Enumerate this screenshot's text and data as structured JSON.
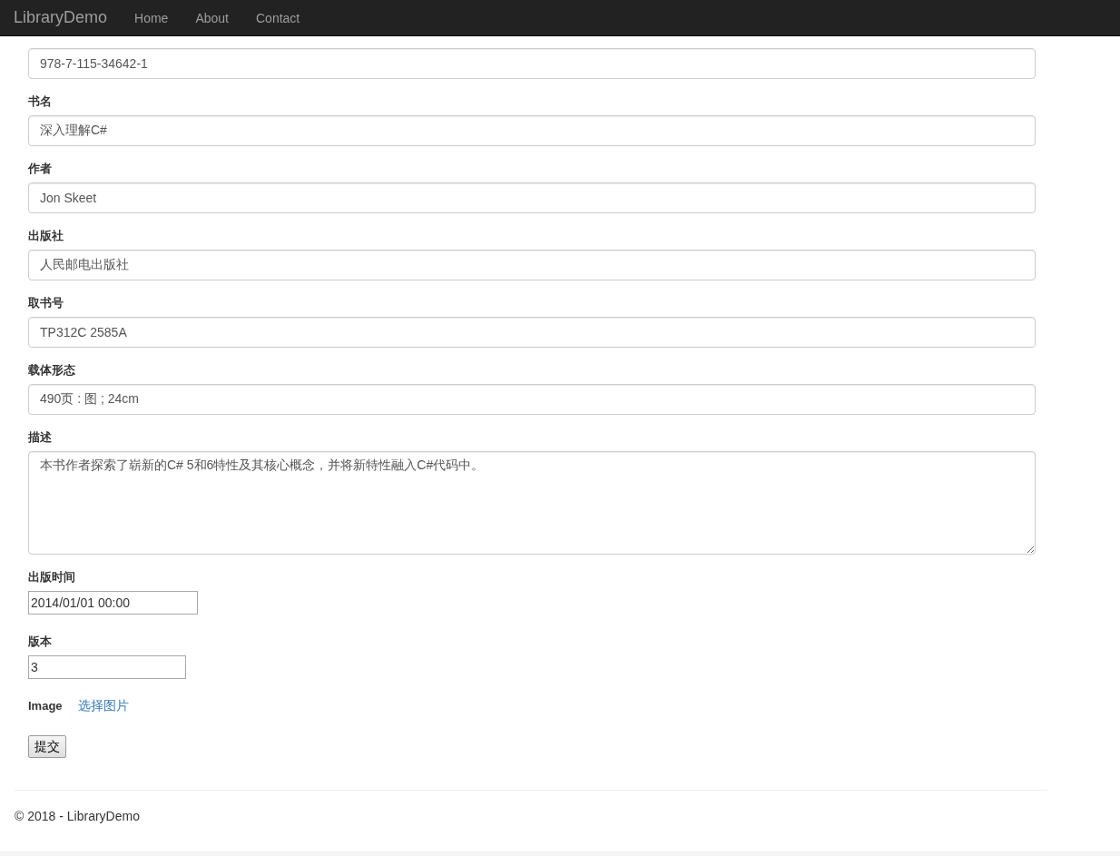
{
  "navbar": {
    "brand": "LibraryDemo",
    "links": [
      {
        "label": "Home"
      },
      {
        "label": "About"
      },
      {
        "label": "Contact"
      }
    ]
  },
  "form": {
    "fields": [
      {
        "kind": "text",
        "value": "978-7-115-34642-1"
      },
      {
        "kind": "text",
        "label": "书名",
        "value": "深入理解C#"
      },
      {
        "kind": "text",
        "label": "作者",
        "value": "Jon Skeet"
      },
      {
        "kind": "text",
        "label": "出版社",
        "value": "人民邮电出版社"
      },
      {
        "kind": "text",
        "label": "取书号",
        "value": "TP312C 2585A"
      },
      {
        "kind": "text",
        "label": "载体形态",
        "value": "490页 : 图 ; 24cm"
      },
      {
        "kind": "textarea",
        "label": "描述",
        "value": "本书作者探索了崭新的C# 5和6特性及其核心概念，并将新特性融入C#代码中。"
      },
      {
        "kind": "datetime",
        "label": "出版时间",
        "value": "2014/01/01 00:00"
      },
      {
        "kind": "number",
        "label": "版本",
        "value": "3"
      },
      {
        "kind": "file",
        "label": "Image",
        "link": "选择图片"
      }
    ],
    "submit": "提交"
  },
  "footer": {
    "text": "© 2018 - LibraryDemo"
  }
}
